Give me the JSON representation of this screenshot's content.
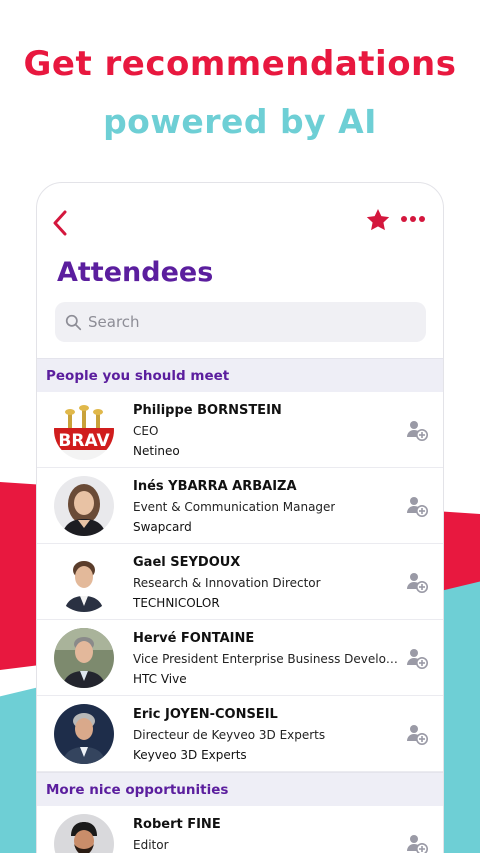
{
  "promo": {
    "line1": "Get recommendations",
    "line2": "powered by AI"
  },
  "colors": {
    "brand_red": "#e8183f",
    "brand_cyan": "#6ecfd5",
    "title_purple": "#5b1e9e"
  },
  "header": {
    "back_icon": "chevron-left-icon",
    "favorite_icon": "star-icon",
    "more_icon": "more-dots-icon"
  },
  "page": {
    "title": "Attendees"
  },
  "search": {
    "placeholder": "Search",
    "value": ""
  },
  "sections": [
    {
      "title": "People you should meet",
      "people": [
        {
          "name": "Philippe BORNSTEIN",
          "title": "CEO",
          "company": "Netineo"
        },
        {
          "name": "Inés YBARRA ARBAIZA",
          "title": "Event & Communication Manager",
          "company": "Swapcard"
        },
        {
          "name": "Gael SEYDOUX",
          "title": "Research & Innovation Director",
          "company": "TECHNICOLOR"
        },
        {
          "name": "Hervé FONTAINE",
          "title": "Vice President Enterprise Business Develop...",
          "company": "HTC Vive"
        },
        {
          "name": "Eric JOYEN-CONSEIL",
          "title": "Directeur de Keyveo 3D Experts",
          "company": "Keyveo 3D Experts"
        }
      ]
    },
    {
      "title": "More nice opportunities",
      "people": [
        {
          "name": "Robert FINE",
          "title": "Editor",
          "company": ""
        }
      ]
    }
  ],
  "row_action_icon": "add-contact-icon"
}
